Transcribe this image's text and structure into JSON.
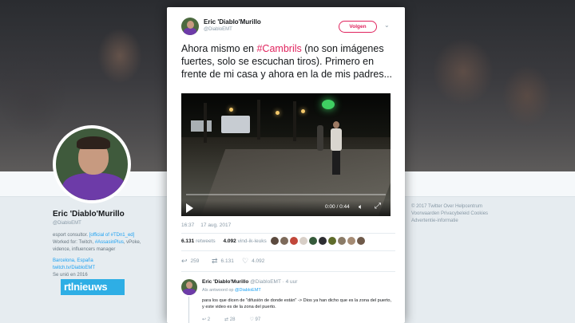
{
  "profile": {
    "name": "Eric 'Diablo'Murillo",
    "handle": "@DiabloEMT",
    "bio_prefix": "esport consultor.",
    "bio_link1": "[official of #TDn1_ed]",
    "bio_line2_prefix": "Worked for: Twitch,",
    "bio_link2": "#AssasinPlus",
    "bio_line2_suffix": ", vPoke,",
    "bio_line3": "vidence, influencers manager",
    "location": "Barcelona, España",
    "link": "twitch.tv/DiabloEMT",
    "joined": "Se unió en 2016"
  },
  "side_footer": {
    "line1": "© 2017 Twitter   Over   Helpcentrum",
    "line2": "Voorwaarden   Privacybeleid   Cookies",
    "line3": "Advertentie-informatie"
  },
  "tweet": {
    "author_name": "Eric 'Diablo'Murillo",
    "author_handle": "@DiabloEMT",
    "follow_label": "Volgen",
    "text_before": "Ahora mismo en ",
    "hashtag": "#Cambrils",
    "text_after": " (no son imágenes fuertes, solo se escuchan tiros). Primero en frente de mi casa y ahora en la de mis padres...",
    "video_time": "0:00 / 0:44",
    "time": "16:37",
    "date": "17 aug. 2017",
    "retweets_count": "6.131",
    "retweets_label": "retweets",
    "likes_count": "4.092",
    "likes_label": "vind-ik-leuks",
    "reply_count": "259",
    "retweet_action_count": "6.131",
    "like_action_count": "4.092",
    "liker_colors": [
      "#5b4a3e",
      "#7d6a5a",
      "#c1473a",
      "#d8cfc7",
      "#355a3a",
      "#2d2d31",
      "#5e6b2a",
      "#8a7a66",
      "#a58b74",
      "#6f5a4a"
    ]
  },
  "reply": {
    "name": "Eric 'Diablo'Murillo",
    "handle": "@DiabloEMT",
    "time": "· 4 uur",
    "reply_to_prefix": "Als antwoord op ",
    "reply_to_handle": "@DiabloEMT",
    "text": "para los que dicen de \"difusión de donde están\" -> Dios ya han dicho que es la zona del puerto, y este video es de la zona del puerto.",
    "reply_count": "2",
    "retweet_count": "28",
    "like_count": "97"
  },
  "watermark": "rtlnieuws"
}
